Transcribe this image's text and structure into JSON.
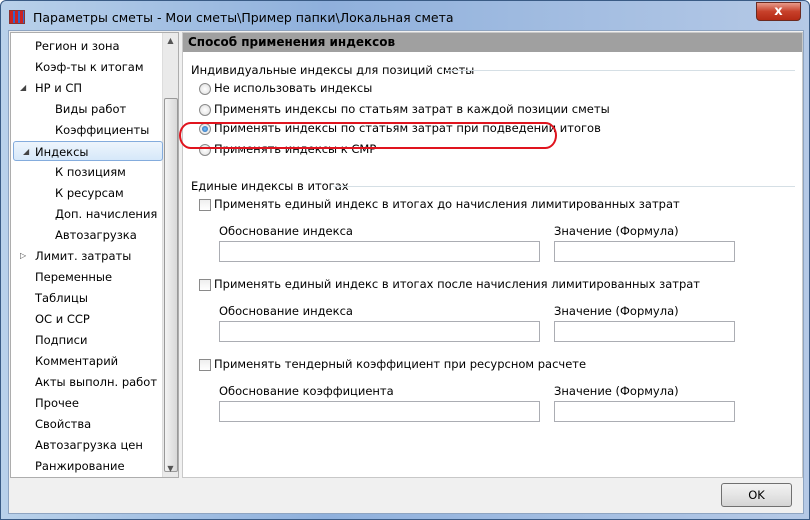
{
  "window": {
    "title": "Параметры сметы - Мои сметы\\Пример папки\\Локальная смета",
    "close_label": "x"
  },
  "tree": {
    "items": [
      {
        "label": "Регион и зона",
        "level": 0
      },
      {
        "label": "Коэф-ты к итогам",
        "level": 0
      },
      {
        "label": "НР и СП",
        "level": 0,
        "expander": "◢"
      },
      {
        "label": "Виды работ",
        "level": 1
      },
      {
        "label": "Коэффициенты",
        "level": 1
      },
      {
        "label": "Индексы",
        "level": 0,
        "expander": "◢",
        "selected": true
      },
      {
        "label": "К позициям",
        "level": 1
      },
      {
        "label": "К ресурсам",
        "level": 1
      },
      {
        "label": "Доп. начисления",
        "level": 1
      },
      {
        "label": "Автозагрузка",
        "level": 1
      },
      {
        "label": "Лимит. затраты",
        "level": 0,
        "expander": "▷"
      },
      {
        "label": "Переменные",
        "level": 0
      },
      {
        "label": "Таблицы",
        "level": 0
      },
      {
        "label": "ОС и ССР",
        "level": 0
      },
      {
        "label": "Подписи",
        "level": 0
      },
      {
        "label": "Комментарий",
        "level": 0
      },
      {
        "label": "Акты выполн. работ",
        "level": 0
      },
      {
        "label": "Прочее",
        "level": 0
      },
      {
        "label": "Свойства",
        "level": 0
      },
      {
        "label": "Автозагрузка цен",
        "level": 0
      },
      {
        "label": "Ранжирование",
        "level": 0
      }
    ]
  },
  "panel": {
    "header": "Способ применения индексов",
    "individual_group": "Индивидуальные индексы для позиций сметы",
    "radios": [
      {
        "label": "Не использовать индексы",
        "checked": false
      },
      {
        "label": "Применять индексы по статьям затрат в каждой позиции сметы",
        "checked": false
      },
      {
        "label": "Применять индексы по статьям затрат при подведении итогов",
        "checked": true
      },
      {
        "label": "Применять индексы к СМР",
        "checked": false
      }
    ],
    "unified_group": "Единые индексы в итогах",
    "checks": [
      {
        "label": "Применять единый индекс в итогах до начисления лимитированных затрат",
        "checked": false,
        "basis_label": "Обоснование индекса",
        "value_label": "Значение (Формула)",
        "basis": "",
        "value": ""
      },
      {
        "label": "Применять единый индекс в итогах после начисления лимитированных затрат",
        "checked": false,
        "basis_label": "Обоснование индекса",
        "value_label": "Значение (Формула)",
        "basis": "",
        "value": ""
      },
      {
        "label": "Применять тендерный коэффициент при ресурсном расчете",
        "checked": false,
        "basis_label": "Обоснование коэффициента",
        "value_label": "Значение (Формула)",
        "basis": "",
        "value": ""
      }
    ]
  },
  "ok_label": "OK"
}
